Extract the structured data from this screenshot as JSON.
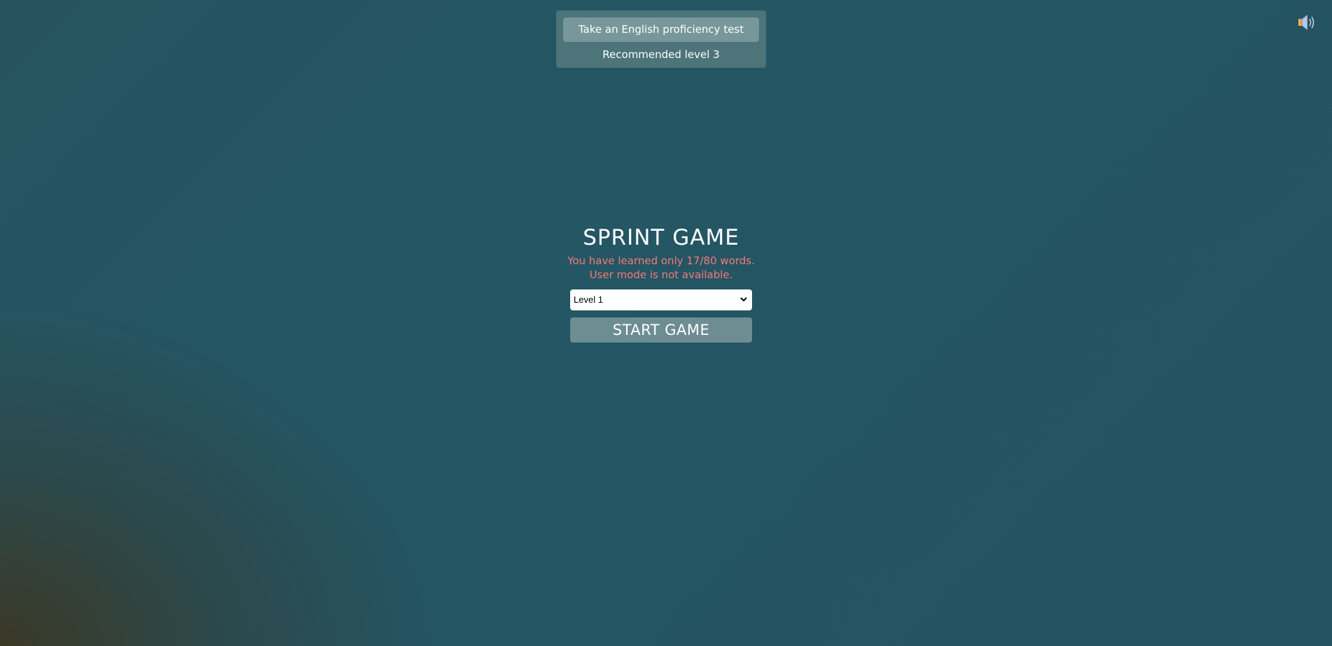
{
  "proficiency_panel": {
    "test_button_label": "Take an English proficiency test",
    "recommendation_text": "Recommended level 3"
  },
  "sound_toggle": {
    "icon": "speaker-icon"
  },
  "game": {
    "title": "SPRINT GAME",
    "warning_line1": "You have learned only 17/80 words.",
    "warning_line2": "User mode is not available.",
    "level_select": {
      "selected": "Level 1"
    },
    "start_button_label": "START GAME"
  },
  "colors": {
    "warning": "#f37a79",
    "panel": "#4d7479",
    "button": "#6d8d92",
    "background": "#255360"
  }
}
